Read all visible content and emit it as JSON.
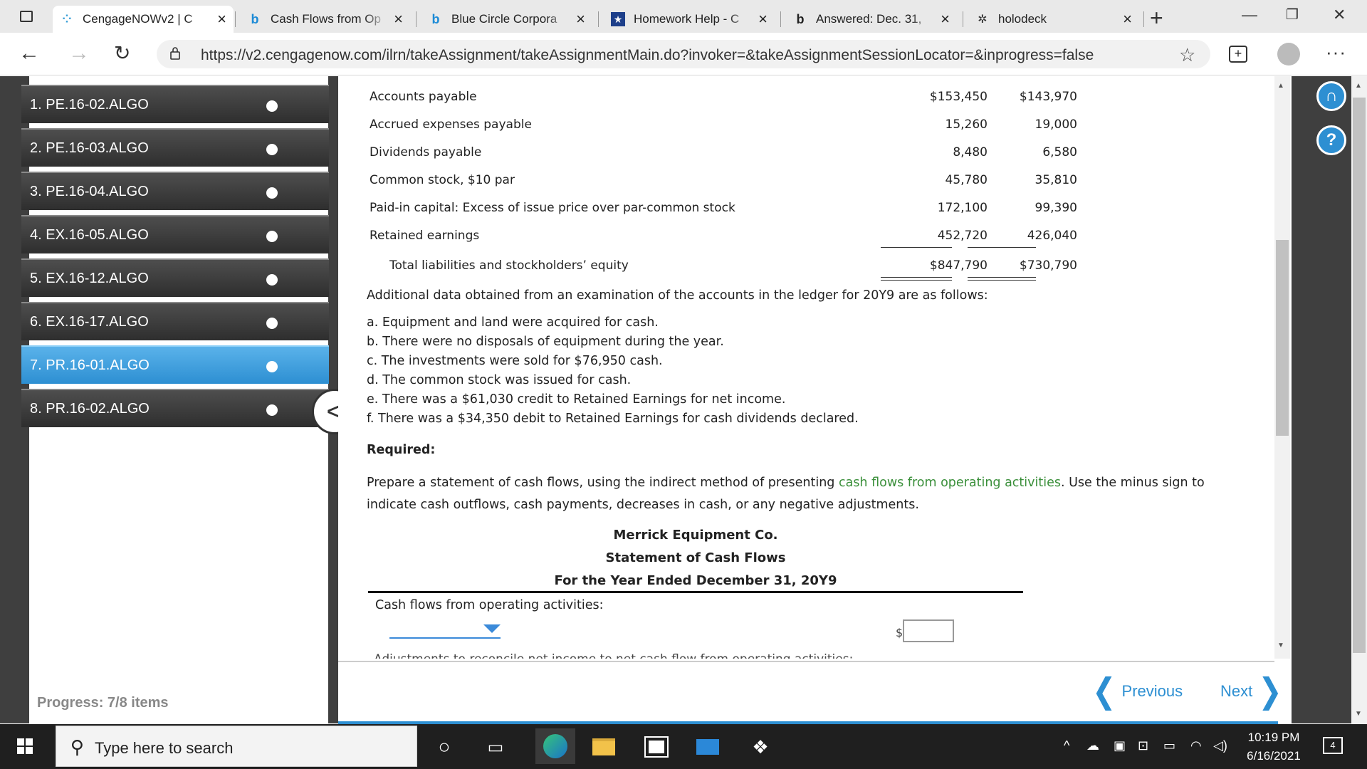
{
  "browser": {
    "tabs": [
      {
        "title": "CengageNOWv2 | C",
        "active": true,
        "favicon": "cengage-icon"
      },
      {
        "title": "Cash Flows from Op",
        "favicon": "bing-icon"
      },
      {
        "title": "Blue Circle Corpora",
        "favicon": "bing-icon"
      },
      {
        "title": "Homework Help - C",
        "favicon": "star-icon"
      },
      {
        "title": "Answered: Dec. 31,",
        "favicon": "bing-icon"
      },
      {
        "title": "holodeck",
        "favicon": "gear-icon"
      }
    ],
    "close_glyph": "×",
    "new_tab_glyph": "+",
    "url": "https://v2.cengagenow.com/ilrn/takeAssignment/takeAssignmentMain.do?invoker=&takeAssignmentSessionLocator=&inprogress=false"
  },
  "sidebar": {
    "items": [
      {
        "label": "1. PE.16-02.ALGO"
      },
      {
        "label": "2. PE.16-03.ALGO"
      },
      {
        "label": "3. PE.16-04.ALGO"
      },
      {
        "label": "4. EX.16-05.ALGO"
      },
      {
        "label": "5. EX.16-12.ALGO"
      },
      {
        "label": "6. EX.16-17.ALGO"
      },
      {
        "label": "7. PR.16-01.ALGO",
        "active": true
      },
      {
        "label": "8. PR.16-02.ALGO"
      }
    ],
    "progress": "Progress: 7/8 items",
    "collapse_glyph": "<"
  },
  "balance_sheet": {
    "rows": [
      {
        "label": "Accounts payable",
        "v1": "$153,450",
        "v2": "$143,970"
      },
      {
        "label": "Accrued expenses payable",
        "v1": "15,260",
        "v2": "19,000"
      },
      {
        "label": "Dividends payable",
        "v1": "8,480",
        "v2": "6,580"
      },
      {
        "label": "Common stock, $10 par",
        "v1": "45,780",
        "v2": "35,810"
      },
      {
        "label": "Paid-in capital: Excess of issue price over par-common stock",
        "v1": "172,100",
        "v2": "99,390"
      },
      {
        "label": "Retained earnings",
        "v1": "452,720",
        "v2": "426,040"
      }
    ],
    "total": {
      "label": "Total liabilities and stockholders’ equity",
      "v1": "$847,790",
      "v2": "$730,790"
    }
  },
  "additional": {
    "intro": "Additional data obtained from an examination of the accounts in the ledger for 20Y9 are as follows:",
    "items": [
      "a. Equipment and land were acquired for cash.",
      "b. There were no disposals of equipment during the year.",
      "c. The investments were sold for $76,950 cash.",
      "d. The common stock was issued for cash.",
      "e. There was a $61,030 credit to Retained Earnings for net income.",
      "f. There was a $34,350 debit to Retained Earnings for cash dividends declared."
    ]
  },
  "required": {
    "heading": "Required:",
    "line1_pre": "Prepare a statement of cash flows, using the indirect method of presenting ",
    "line1_link": "cash flows from operating activities",
    "line1_post": ". Use the minus sign to",
    "line2": "indicate cash outflows, cash payments, decreases in cash, or any negative adjustments."
  },
  "statement": {
    "company": "Merrick Equipment Co.",
    "title": "Statement of Cash Flows",
    "period": "For the Year Ended December 31, 20Y9",
    "section": "Cash flows from operating activities:",
    "dollar_sign": "$",
    "clipped_line": "Adjustments to reconcile net income to net cash flow from operating activities:"
  },
  "navigation": {
    "previous": "Previous",
    "next": "Next"
  },
  "taskbar": {
    "search_placeholder": "Type here to search",
    "time": "10:19 PM",
    "date": "6/16/2021",
    "notification_count": "4"
  },
  "colors": {
    "accent": "#2d8fd2",
    "link_green": "#3a8f3a",
    "sidebar_dark": "#3f3f3f"
  }
}
